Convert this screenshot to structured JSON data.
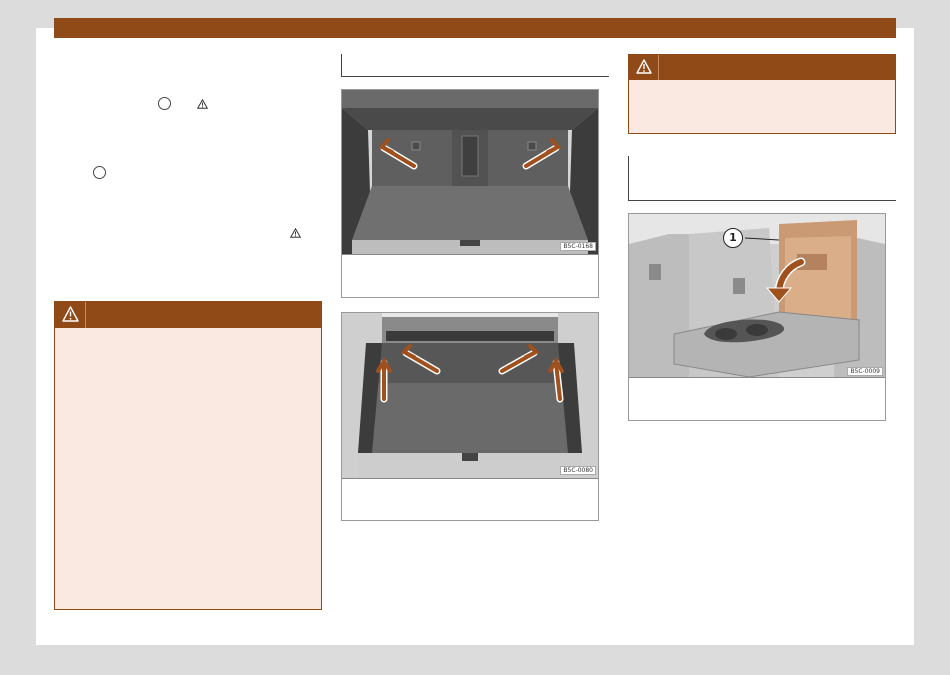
{
  "figures": [
    {
      "code": "B5C-0168"
    },
    {
      "code": "B5C-0080"
    },
    {
      "code": "B5C-0009",
      "callout": "1"
    }
  ],
  "colors": {
    "brand": "#8f4a18",
    "warning_bg": "#f9e9e0",
    "page_bg": "#dcdcdc"
  },
  "icons": [
    "warning-triangle-icon",
    "circle-marker-icon",
    "arrow-icon"
  ]
}
